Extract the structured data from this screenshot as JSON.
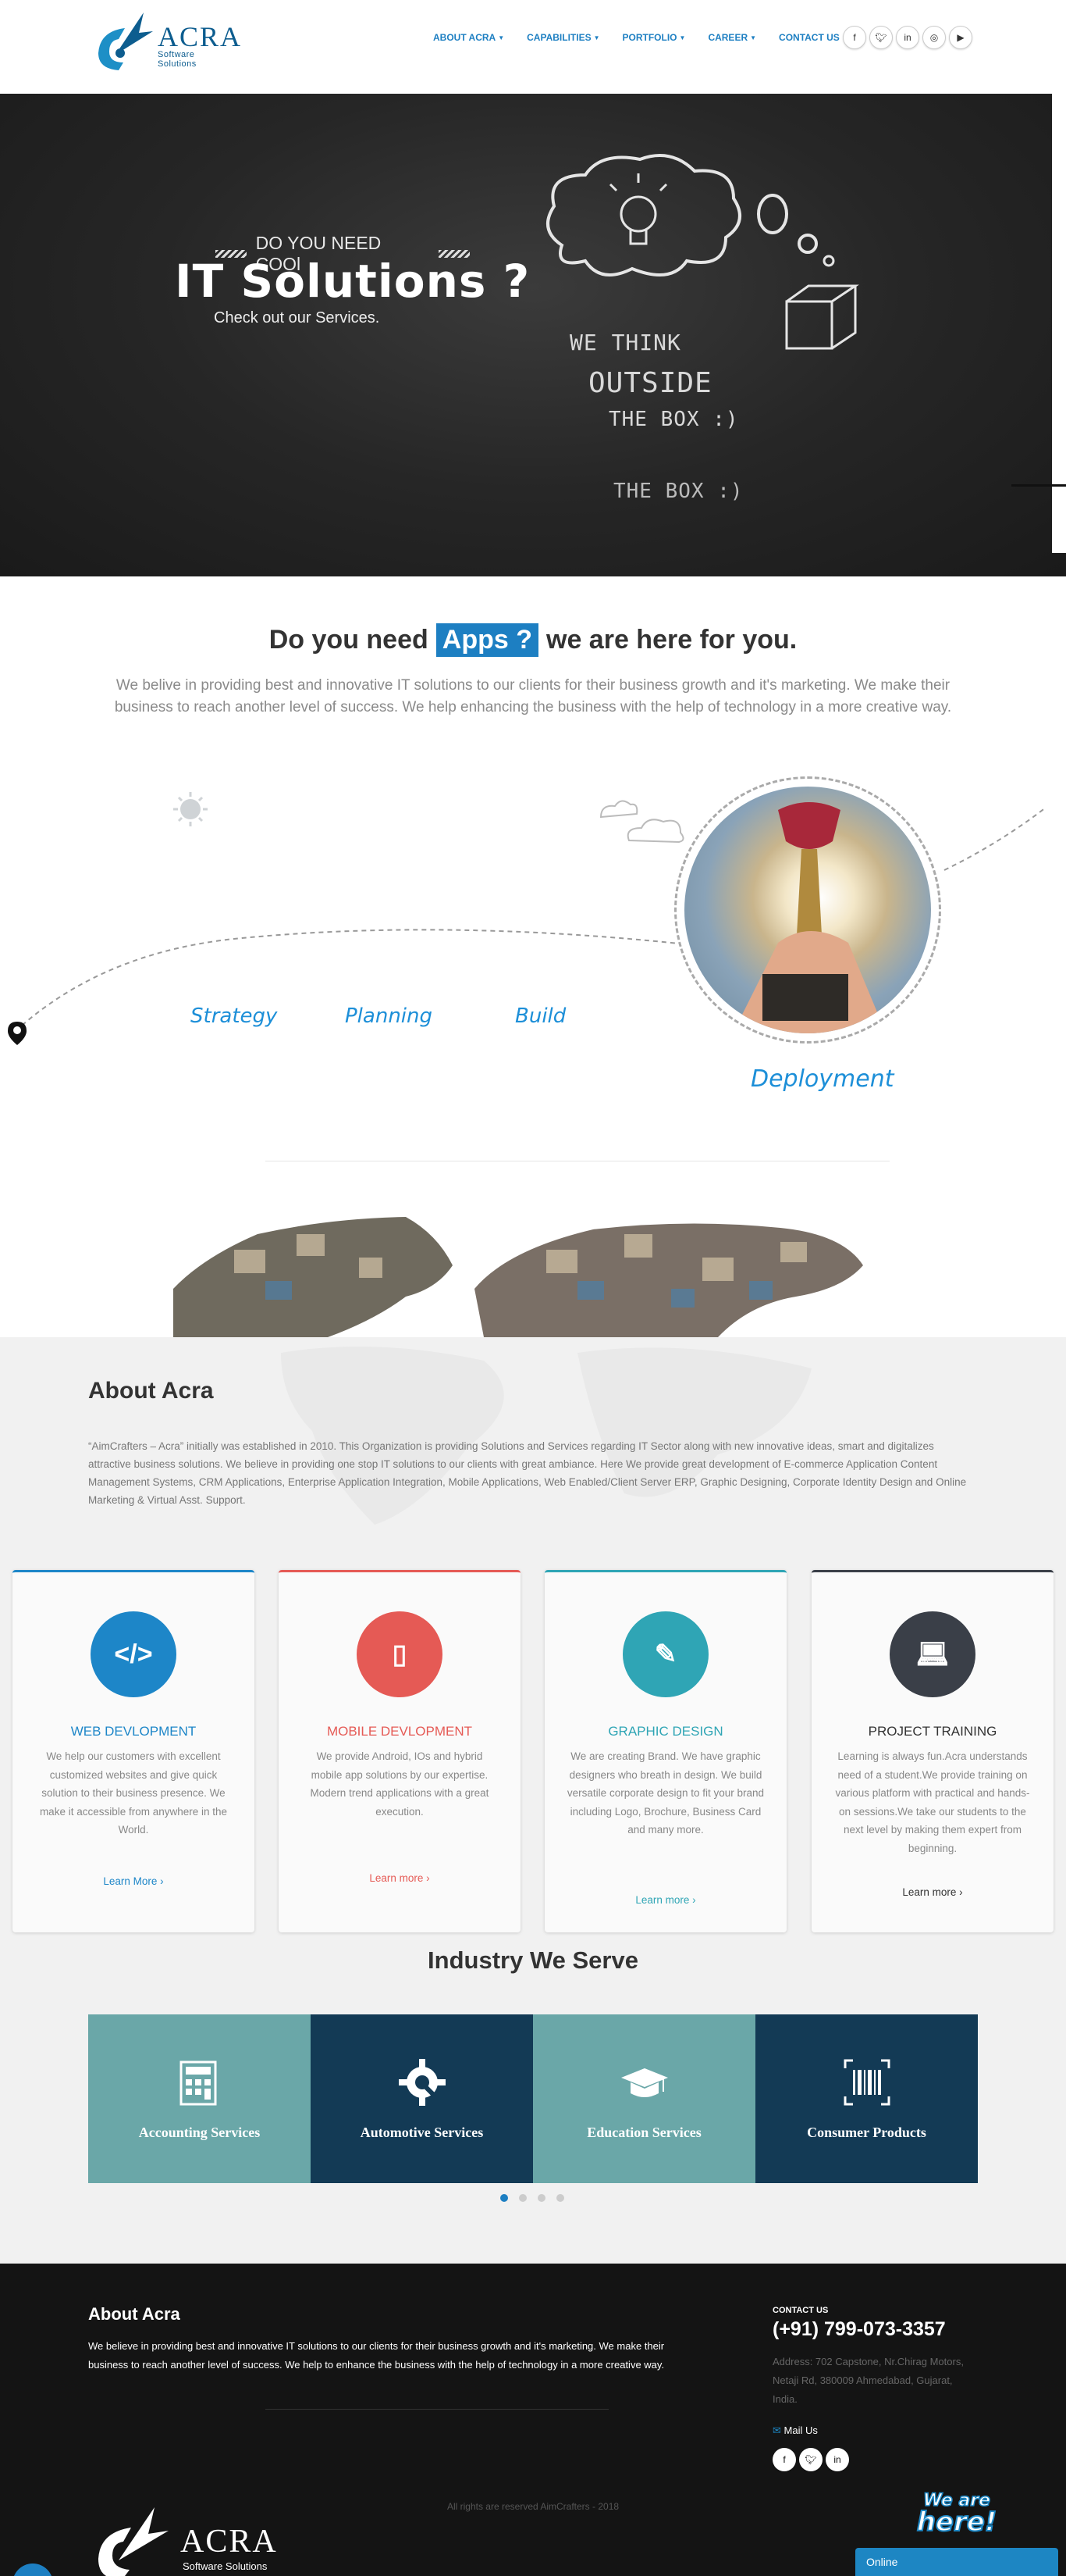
{
  "header": {
    "logo_text": "ACRA",
    "logo_sub": "Software Solutions",
    "nav": [
      {
        "label": "ABOUT ACRA",
        "dropdown": true
      },
      {
        "label": "CAPABILITIES",
        "dropdown": true
      },
      {
        "label": "PORTFOLIO",
        "dropdown": true
      },
      {
        "label": "CAREER",
        "dropdown": true
      },
      {
        "label": "CONTACT US",
        "dropdown": false
      }
    ],
    "socials": [
      "facebook-icon",
      "twitter-icon",
      "linkedin-icon",
      "instagram-icon",
      "youtube-icon"
    ]
  },
  "hero": {
    "kicker": "DO YOU NEED COOl",
    "title": "IT Solutions ?",
    "subtitle": "Check out our Services.",
    "chalk_lines": [
      "WE THINK",
      "OUTSIDE",
      "THE BOX :)",
      "THE BOX :)"
    ]
  },
  "intro": {
    "heading_before": "Do you need",
    "heading_highlight": "Apps ?",
    "heading_after": "we are here for you.",
    "text": "We belive in providing best and innovative IT solutions to our clients for their business growth and it's marketing. We make their business to reach another level of success. We help enhancing the business with the help of technology in a more creative way."
  },
  "process": {
    "steps": [
      "Strategy",
      "Planning",
      "Build",
      "Deployment"
    ]
  },
  "about": {
    "title_light": "About",
    "title_bold": "Acra",
    "text": "“AimCrafters – Acra” initially was established in 2010. This Organization is providing Solutions and Services regarding IT Sector along with new innovative ideas, smart and digitalizes attractive business solutions. We believe in providing one stop IT solutions to our clients with great ambiance. Here We provide great development of E-commerce Application Content Management Systems, CRM Applications, Enterprise Application Integration, Mobile Applications, Web Enabled/Client Server ERP, Graphic Designing, Corporate Identity Design and Online Marketing & Virtual Asst. Support."
  },
  "cards": [
    {
      "title": "WEB DEVLOPMENT",
      "desc": "We help our customers with excellent customized websites and give quick solution to their business presence. We make it accessible from anywhere in the World.",
      "link": "Learn More ›",
      "color": "#1d86c8",
      "icon": "code-icon"
    },
    {
      "title": "MOBILE DEVLOPMENT",
      "desc": "We provide Android, IOs and hybrid mobile app solutions by our expertise. Modern trend applications with a great execution.",
      "link": "Learn more ›",
      "color": "#e55a55",
      "icon": "mobile-icon"
    },
    {
      "title": "GRAPHIC DESIGN",
      "desc": "We are creating Brand. We have graphic designers who breath in design. We build versatile corporate design to fit your brand including Logo, Brochure, Business Card and many more.",
      "link": "Learn more ›",
      "color": "#2fa5b5",
      "icon": "brush-icon"
    },
    {
      "title": "PROJECT TRAINING",
      "desc": "Learning is always fun.Acra understands need of a student.We provide training on various platform with practical and hands-on sessions.We take our students to the next level by making them expert from beginning.",
      "link": "Learn more ›",
      "color": "#3a3f48",
      "icon": "laptop-icon"
    }
  ],
  "industry": {
    "title_bold": "Industry",
    "title_light": "We Serve",
    "items": [
      {
        "label": "Accounting Services",
        "color": "#6aa7a8",
        "icon": "calculator-icon"
      },
      {
        "label": "Automotive Services",
        "color": "#133a55",
        "icon": "gear-wrench-icon"
      },
      {
        "label": "Education Services",
        "color": "#6aa7a8",
        "icon": "graduation-cap-icon"
      },
      {
        "label": "Consumer Products",
        "color": "#133a55",
        "icon": "barcode-icon"
      }
    ],
    "slides": 4,
    "active_slide": 1
  },
  "footer": {
    "about_title": "About Acra",
    "about_text": "We believe in providing best and innovative IT solutions to our clients for their business growth and it's marketing. We make their business to reach another level of success. We help to enhance the business with the help of technology in a more creative way.",
    "contact_label": "CONTACT US",
    "phone": "(+91) 799-073-3357",
    "address": "Address: 702 Capstone, Nr.Chirag Motors, Netaji Rd, 380009 Ahmedabad, Gujarat, India.",
    "mail": "Mail Us",
    "copyright": "All rights are reserved AimCrafters - 2018",
    "logo_text": "ACRA",
    "logo_sub": "Software Solutions",
    "chat_badge": "We are here!",
    "chat_status": "Online"
  }
}
